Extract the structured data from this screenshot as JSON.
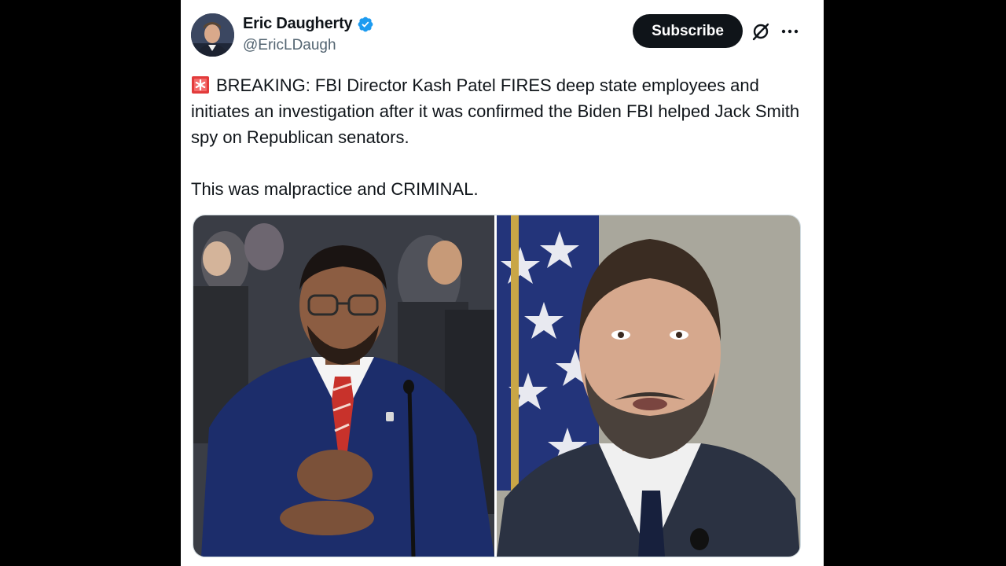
{
  "author": {
    "display_name": "Eric Daugherty",
    "handle": "@EricLDaugh",
    "verified_icon": "verified-badge-icon"
  },
  "actions": {
    "subscribe_label": "Subscribe",
    "grok_icon": "grok-icon",
    "more_icon": "more-options-icon"
  },
  "tweet": {
    "emoji": "siren-emoji",
    "paragraph1": "BREAKING: FBI Director Kash Patel FIRES deep state employees and initiates an investigation after it was confirmed the Biden FBI helped Jack Smith spy on Republican senators.",
    "paragraph2": "This was malpractice and CRIMINAL."
  },
  "media": {
    "count": 2
  },
  "colors": {
    "background": "#000000",
    "card": "#ffffff",
    "text_primary": "#0f1419",
    "text_secondary": "#536471",
    "verified_blue": "#1d9bf0",
    "button_bg": "#0f1419"
  }
}
